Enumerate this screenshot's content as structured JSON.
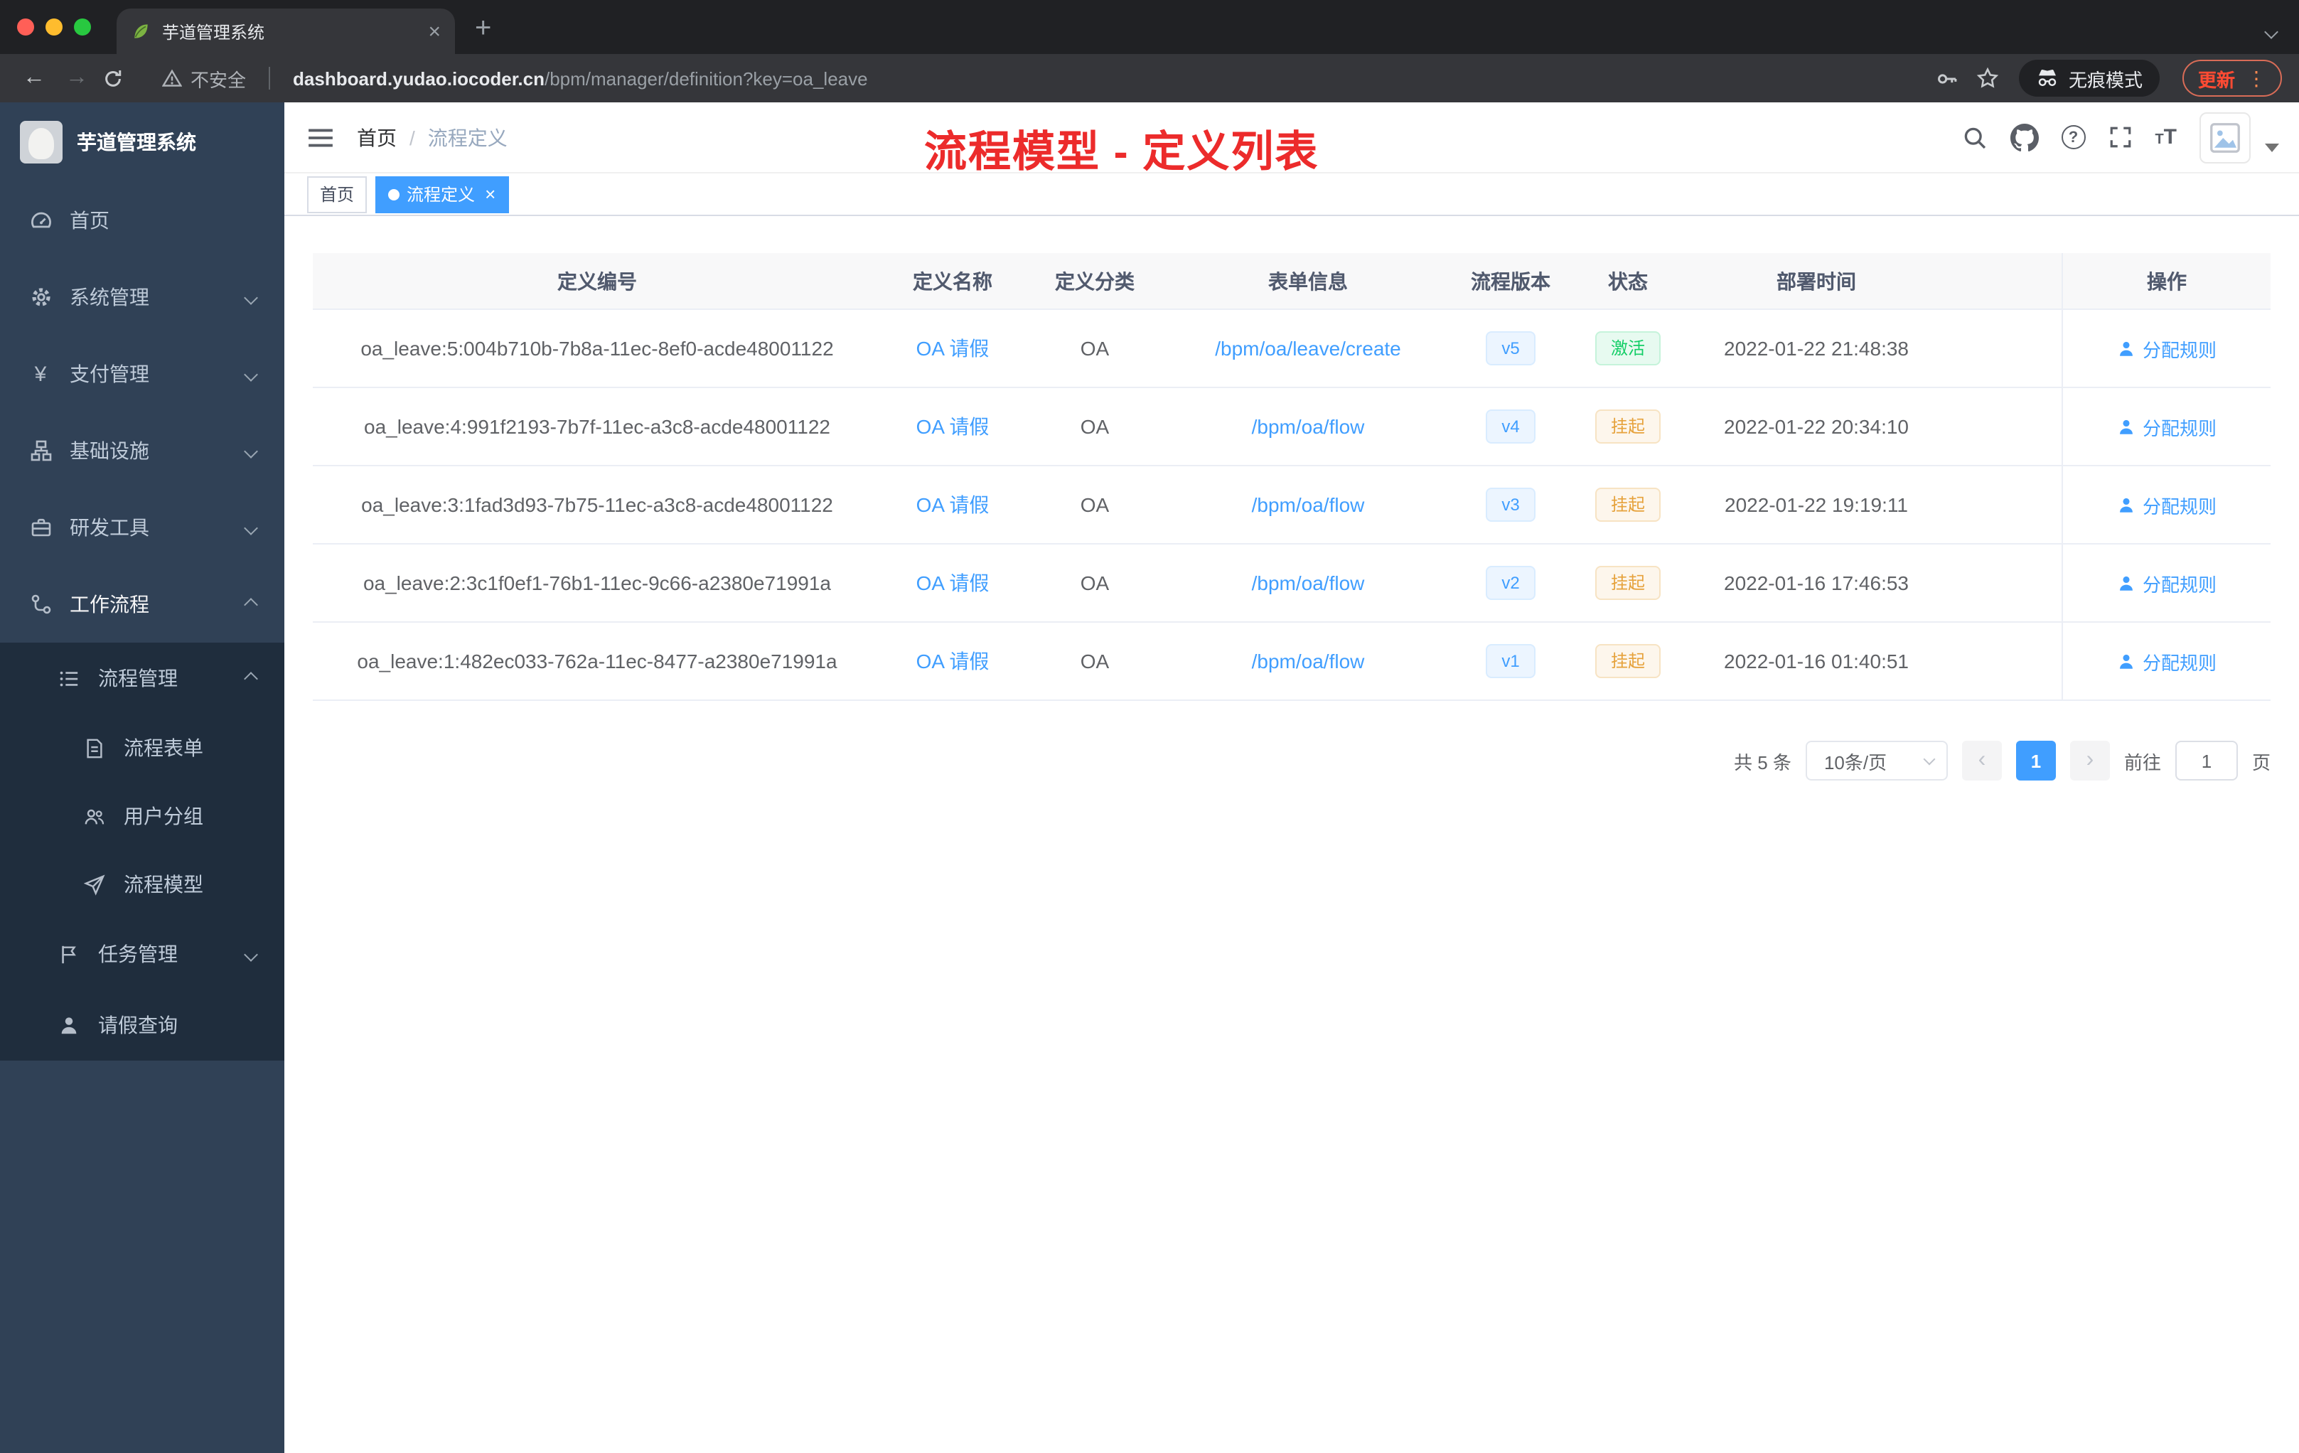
{
  "colors": {
    "accent": "#409eff",
    "annotation_red": "#ec2b2b",
    "active_green": "#13ce66",
    "warning_orange": "#e6a23c",
    "sidebar_bg": "#304156",
    "submenu_bg": "#1f2d3d",
    "chrome_dark": "#202124",
    "toolbar_dark": "#35363a"
  },
  "icons": {
    "close": "×",
    "plus": "+",
    "back": "←",
    "forward": "→",
    "kebab": "⋮",
    "question": "?",
    "prev": "‹",
    "next": "›",
    "t_small": "T",
    "t_big": "T",
    "yen": "¥"
  },
  "browser": {
    "tab_title": "芋道管理系统",
    "security_label": "不安全",
    "url_host": "dashboard.yudao.iocoder.cn",
    "url_path": "/bpm/manager/definition?key=oa_leave",
    "incognito_label": "无痕模式",
    "update_label": "更新"
  },
  "sidebar": {
    "logo_title": "芋道管理系统",
    "items": [
      {
        "label": "首页"
      },
      {
        "label": "系统管理"
      },
      {
        "label": "支付管理"
      },
      {
        "label": "基础设施"
      },
      {
        "label": "研发工具"
      },
      {
        "label": "工作流程"
      }
    ],
    "submenu": {
      "process": {
        "label": "流程管理"
      },
      "children": [
        {
          "label": "流程表单"
        },
        {
          "label": "用户分组"
        },
        {
          "label": "流程模型"
        }
      ],
      "task": {
        "label": "任务管理"
      },
      "leave": {
        "label": "请假查询"
      }
    }
  },
  "navbar": {
    "breadcrumb_home": "首页",
    "breadcrumb_sep": "/",
    "breadcrumb_current": "流程定义",
    "annotation": "流程模型 - 定义列表"
  },
  "tags": [
    {
      "label": "首页"
    },
    {
      "label": "流程定义"
    }
  ],
  "table": {
    "columns": [
      "定义编号",
      "定义名称",
      "定义分类",
      "表单信息",
      "流程版本",
      "状态",
      "部署时间",
      "操作"
    ],
    "rows": [
      {
        "id": "oa_leave:5:004b710b-7b8a-11ec-8ef0-acde48001122",
        "name": "OA 请假",
        "category": "OA",
        "form": "/bpm/oa/leave/create",
        "version": "v5",
        "status": "激活",
        "status_class": "cell-tag status-active",
        "time": "2022-01-22 21:48:38",
        "action": "分配规则"
      },
      {
        "id": "oa_leave:4:991f2193-7b7f-11ec-a3c8-acde48001122",
        "name": "OA 请假",
        "category": "OA",
        "form": "/bpm/oa/flow",
        "version": "v4",
        "status": "挂起",
        "status_class": "cell-tag status-suspend",
        "time": "2022-01-22 20:34:10",
        "action": "分配规则"
      },
      {
        "id": "oa_leave:3:1fad3d93-7b75-11ec-a3c8-acde48001122",
        "name": "OA 请假",
        "category": "OA",
        "form": "/bpm/oa/flow",
        "version": "v3",
        "status": "挂起",
        "status_class": "cell-tag status-suspend",
        "time": "2022-01-22 19:19:11",
        "action": "分配规则"
      },
      {
        "id": "oa_leave:2:3c1f0ef1-76b1-11ec-9c66-a2380e71991a",
        "name": "OA 请假",
        "category": "OA",
        "form": "/bpm/oa/flow",
        "version": "v2",
        "status": "挂起",
        "status_class": "cell-tag status-suspend",
        "time": "2022-01-16 17:46:53",
        "action": "分配规则"
      },
      {
        "id": "oa_leave:1:482ec033-762a-11ec-8477-a2380e71991a",
        "name": "OA 请假",
        "category": "OA",
        "form": "/bpm/oa/flow",
        "version": "v1",
        "status": "挂起",
        "status_class": "cell-tag status-suspend",
        "time": "2022-01-16 01:40:51",
        "action": "分配规则"
      }
    ]
  },
  "pagination": {
    "total": "共 5 条",
    "page_size": "10条/页",
    "current_page": "1",
    "goto_label": "前往",
    "page_unit": "页",
    "goto_value": "1"
  }
}
